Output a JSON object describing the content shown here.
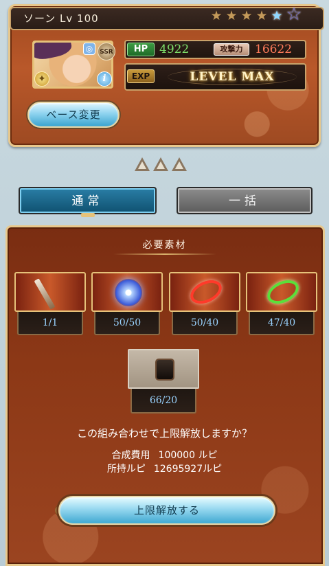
{
  "character": {
    "name": "ソーン",
    "level_text": "Lv 100",
    "rarity_badge": "SSR",
    "stars_filled": 4,
    "stars_total": 6,
    "hp_label": "HP",
    "hp_value": "4922",
    "atk_label": "攻撃力",
    "atk_value": "16622",
    "exp_label": "EXP",
    "exp_status": "LEVEL MAX",
    "base_change_label": "ベース変更"
  },
  "tabs": {
    "normal_label": "通常",
    "bulk_label": "一括",
    "selected": "normal"
  },
  "materials": {
    "title": "必要素材",
    "items": [
      {
        "count": "1/1",
        "icon": "weapon-icon"
      },
      {
        "count": "50/50",
        "icon": "blue-orb-icon"
      },
      {
        "count": "50/40",
        "icon": "red-ring-icon"
      },
      {
        "count": "47/40",
        "icon": "green-ring-icon"
      }
    ],
    "extra_item": {
      "count": "66/20",
      "icon": "treasure-chest-icon"
    }
  },
  "confirm": {
    "question": "この組み合わせで上限解放しますか？",
    "cost_label": "合成費用",
    "cost_value": "100000 ルピ",
    "owned_label": "所持ルピ",
    "owned_value": "12695927ルピ",
    "button_label": "上限解放する"
  },
  "colors": {
    "panel_brown": "#8c3816",
    "gold_border": "#e8c88c",
    "selected_tab": "#1e6c92",
    "count_text": "#9ad3ff"
  }
}
